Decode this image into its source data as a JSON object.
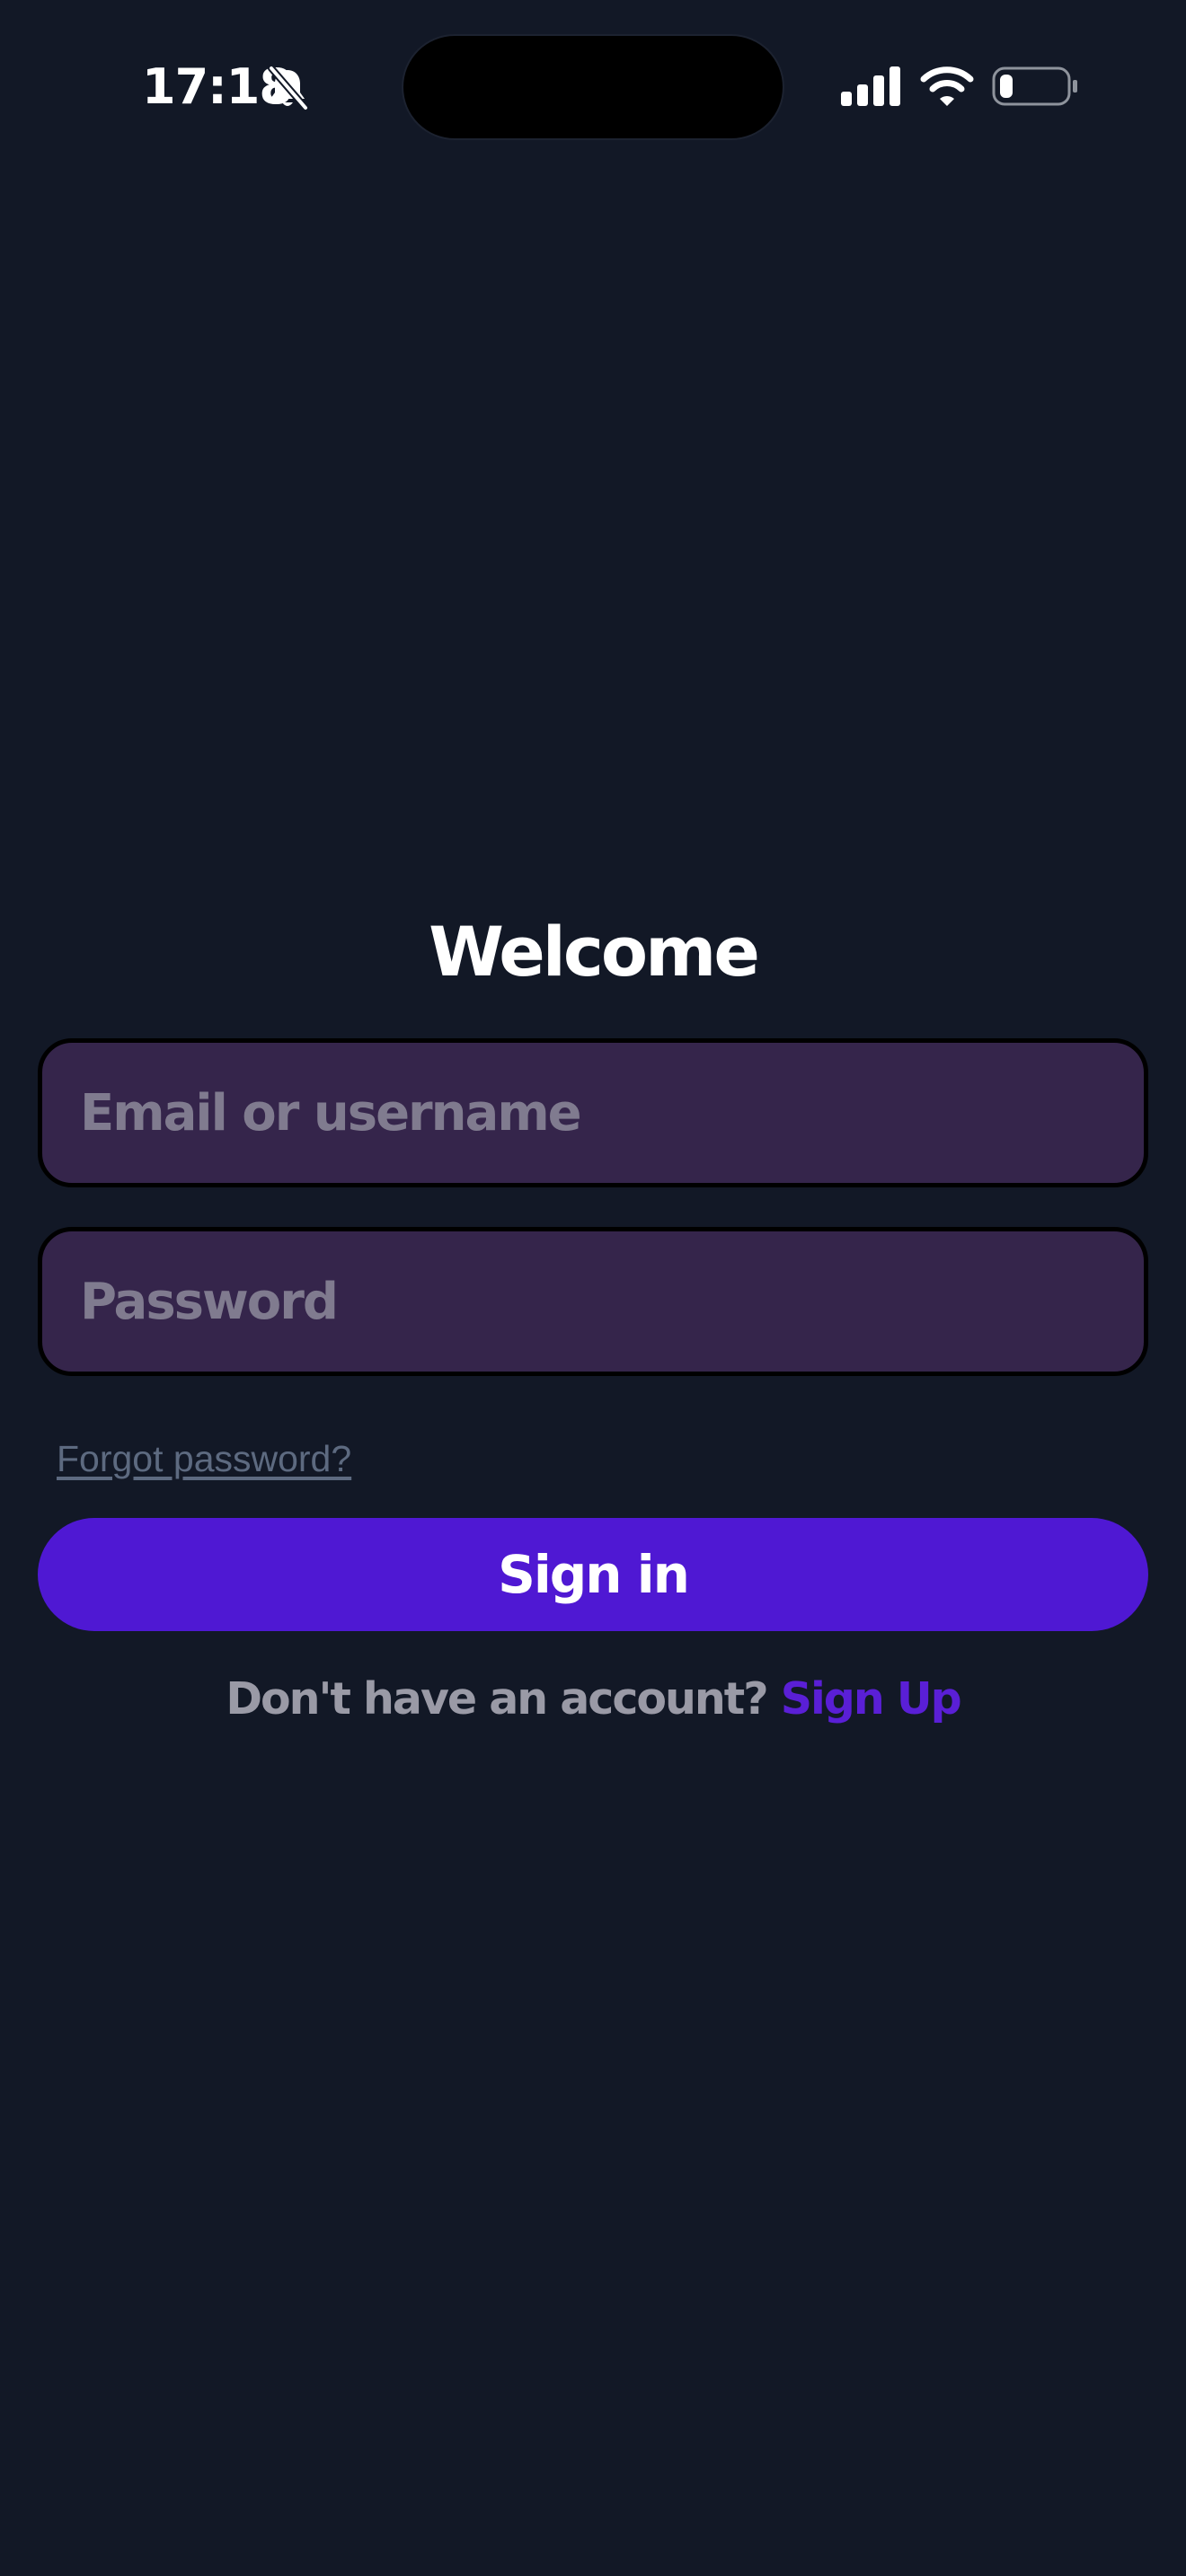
{
  "status_bar": {
    "time": "17:18",
    "icons": [
      "bell-off-icon",
      "cellular-signal-icon",
      "wifi-icon",
      "battery-icon"
    ],
    "battery_level": 0.2
  },
  "login": {
    "title": "Welcome",
    "email_placeholder": "Email or username",
    "email_value": "",
    "password_placeholder": "Password",
    "password_value": "",
    "forgot_password_label": "Forgot password?",
    "sign_in_label": "Sign in",
    "signup_prompt": "Don't have an account?",
    "signup_link_label": "Sign Up"
  },
  "colors": {
    "background": "#121826",
    "field_background": "#35254b",
    "primary": "#4f18d3",
    "link_accent": "#5a1fd6",
    "muted_text": "#9a9aa6",
    "forgot_link": "#5d6a80"
  }
}
